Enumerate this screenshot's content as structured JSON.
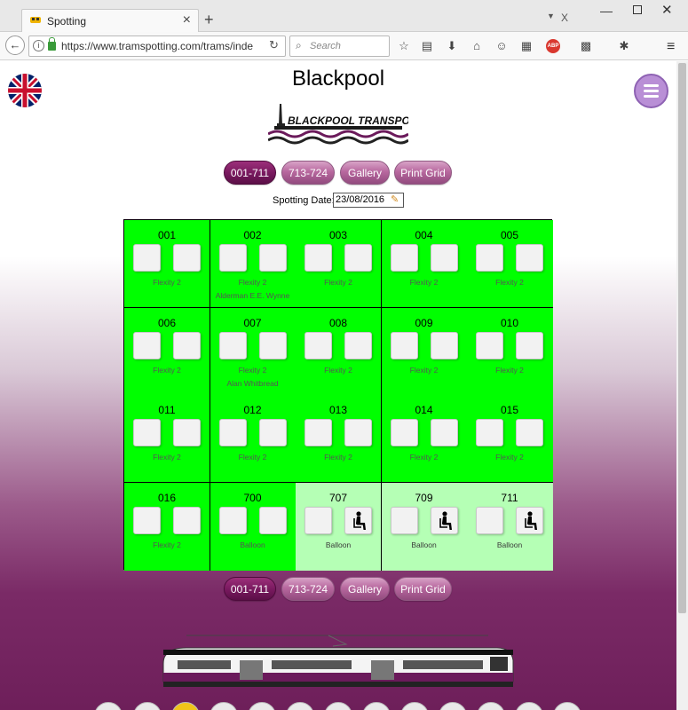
{
  "browser": {
    "tab_title": "Spotting",
    "new_tab_symbol": "+",
    "url": "https://www.tramspotting.com/trams/inde",
    "search_placeholder": "Search"
  },
  "page": {
    "title": "Blackpool",
    "logo_text": "BLACKPOOL TRANSPORT",
    "top_buttons": [
      {
        "label": "001-711",
        "active": true
      },
      {
        "label": "713-724",
        "active": false
      },
      {
        "label": "Gallery",
        "active": false
      },
      {
        "label": "Print Grid",
        "active": false
      }
    ],
    "bottom_buttons": [
      {
        "label": "001-711",
        "active": true
      },
      {
        "label": "713-724",
        "active": false
      },
      {
        "label": "Gallery",
        "active": false
      },
      {
        "label": "Print Grid",
        "active": false
      }
    ],
    "spotting_date_label": "Spotting Date:",
    "spotting_date_value": "23/08/2016"
  },
  "grid": [
    {
      "number": "001",
      "type": "Flexity 2",
      "name": "",
      "seat": false
    },
    {
      "number": "002",
      "type": "Flexity 2",
      "name": "Alderman E.E. Wynne",
      "seat": false
    },
    {
      "number": "003",
      "type": "Flexity 2",
      "name": "",
      "seat": false
    },
    {
      "number": "004",
      "type": "Flexity 2",
      "name": "",
      "seat": false
    },
    {
      "number": "005",
      "type": "Flexity 2",
      "name": "",
      "seat": false
    },
    {
      "number": "006",
      "type": "Flexity 2",
      "name": "",
      "seat": false
    },
    {
      "number": "007",
      "type": "Flexity 2",
      "name": "Alan Whitbread",
      "seat": false
    },
    {
      "number": "008",
      "type": "Flexity 2",
      "name": "",
      "seat": false
    },
    {
      "number": "009",
      "type": "Flexity 2",
      "name": "",
      "seat": false
    },
    {
      "number": "010",
      "type": "Flexity 2",
      "name": "",
      "seat": false
    },
    {
      "number": "011",
      "type": "Flexity 2",
      "name": "",
      "seat": false
    },
    {
      "number": "012",
      "type": "Flexity 2",
      "name": "",
      "seat": false
    },
    {
      "number": "013",
      "type": "Flexity 2",
      "name": "",
      "seat": false
    },
    {
      "number": "014",
      "type": "Flexity 2",
      "name": "",
      "seat": false
    },
    {
      "number": "015",
      "type": "Flexity 2",
      "name": "",
      "seat": false
    },
    {
      "number": "016",
      "type": "Flexity 2",
      "name": "",
      "seat": false
    },
    {
      "number": "700",
      "type": "Balloon",
      "name": "",
      "seat": false
    },
    {
      "number": "707",
      "type": "Balloon",
      "name": "",
      "seat": true
    },
    {
      "number": "709",
      "type": "Balloon",
      "name": "",
      "seat": true
    },
    {
      "number": "711",
      "type": "Balloon",
      "name": "",
      "seat": true
    }
  ],
  "colors": {
    "cell_spotted": "#00ff00",
    "cell_partial": "#b5ffb5",
    "accent": "#7a1a60"
  }
}
